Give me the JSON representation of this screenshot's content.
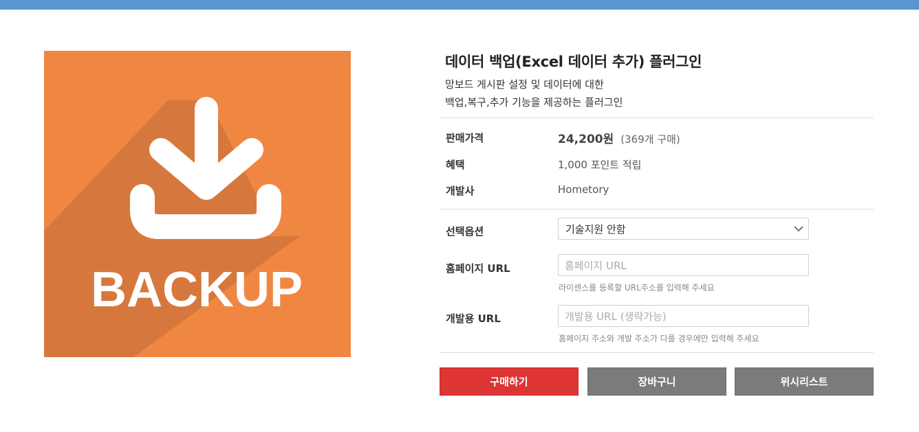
{
  "colors": {
    "topbar": "#5a96cf",
    "image_bg": "#ef8743",
    "image_shadow": "#d6783d",
    "buy_button": "#dd3434",
    "gray_button": "#7b7b7b"
  },
  "image": {
    "text": "BACKUP",
    "icon": "download-icon"
  },
  "product": {
    "title": "데이터 백업(Excel 데이터 추가) 플러그인",
    "subtitle_line1": "망보드 게시판 설정 및 데이터에 대한",
    "subtitle_line2": "백업,복구,추가 기능을 제공하는 플러그인"
  },
  "details": {
    "price_label": "판매가격",
    "price": "24,200원",
    "purchase_count": "(369개 구매)",
    "benefit_label": "혜택",
    "benefit": "1,000 포인트 적립",
    "developer_label": "개발사",
    "developer": "Hometory"
  },
  "options": {
    "select_label": "선택옵션",
    "select_value": "기술지원 안함",
    "select_icon": "chevron-down-icon",
    "homepage_label": "홈페이지 URL",
    "homepage_placeholder": "홈페이지 URL",
    "homepage_hint": "라이센스를 등록할 URL주소를 입력해 주세요",
    "dev_label": "개발용 URL",
    "dev_placeholder": "개발용 URL (생략가능)",
    "dev_hint": "홈페이지 주소와 개발 주소가 다를 경우에만 입력해 주세요"
  },
  "buttons": {
    "buy": "구매하기",
    "cart": "장바구니",
    "wishlist": "위시리스트"
  }
}
